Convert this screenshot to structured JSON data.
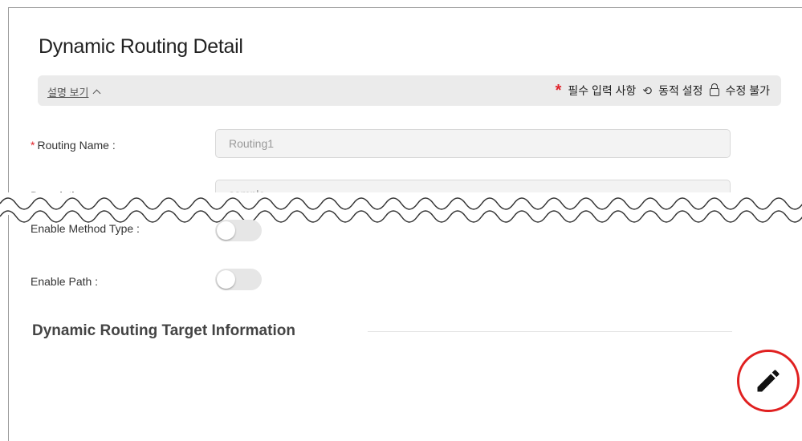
{
  "page": {
    "title": "Dynamic Routing Detail"
  },
  "info_bar": {
    "toggle_label": "설명 보기",
    "required_label": "필수 입력 사항",
    "dynamic_label": "동적 설정",
    "readonly_label": "수정 불가",
    "required_marker": "*"
  },
  "form": {
    "routing_name": {
      "label": "Routing Name :",
      "value": "Routing1"
    },
    "description": {
      "label": "Description :",
      "value": "sample"
    },
    "enable_method_type": {
      "label": "Enable Method Type :",
      "enabled": false
    },
    "enable_path": {
      "label": "Enable Path :",
      "enabled": false
    }
  },
  "section": {
    "target_info_title": "Dynamic Routing Target Information"
  },
  "colors": {
    "required": "#e0242c",
    "edit_highlight": "#e02020",
    "info_bar_bg": "#ebebeb"
  },
  "icons": [
    "refresh-icon",
    "lock-icon",
    "pencil-icon",
    "chevron-up-icon"
  ]
}
